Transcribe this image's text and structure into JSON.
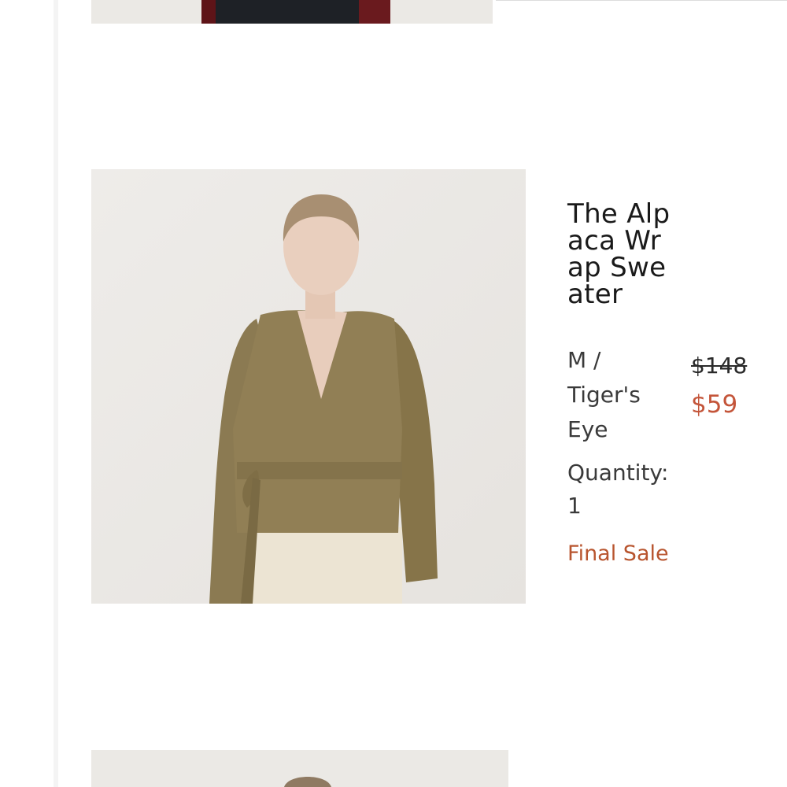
{
  "previous_item": {
    "image_label": "product-photo-previous"
  },
  "product": {
    "title": "The Alpaca Wrap Sweater",
    "variant": "M / Tiger's Eye",
    "quantity_label": "Quantity:",
    "quantity_value": "1",
    "final_sale_label": "Final Sale",
    "original_price": "$148",
    "sale_price": "$59"
  },
  "next_item": {
    "image_label": "product-photo-next"
  },
  "colors": {
    "sale_price": "#c4553a",
    "final_sale": "#b8552f",
    "text_primary": "#1a1a1a",
    "text_secondary": "#3a3a3a"
  }
}
